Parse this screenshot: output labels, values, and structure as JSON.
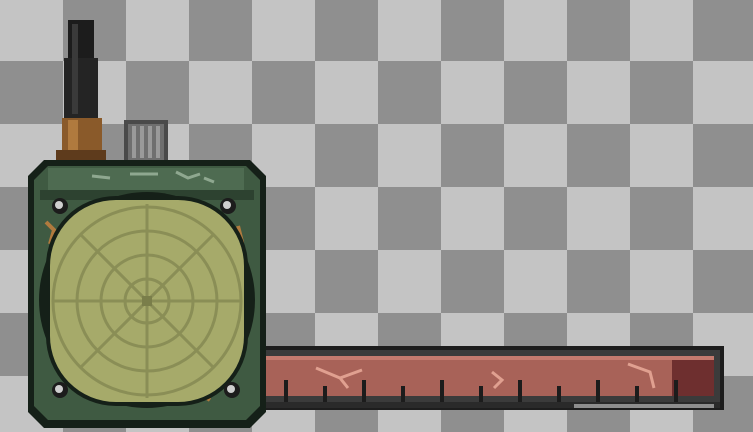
{
  "scene": {
    "kind": "radar scanner device sprite on transparent background",
    "colors": {
      "checker_light": "#c4c4c4",
      "checker_dark": "#8f8f8f",
      "casing": "#3f5a42",
      "casing_dark": "#1f2e22",
      "screen": "#a6aa6a",
      "screen_lines": "#8a8e56",
      "bar_fill": "#a86258",
      "bar_end": "#6e2f2f",
      "antenna": "#1c1c1c",
      "antenna_base": "#8a5a2a",
      "knob": "#6f6f6f"
    }
  },
  "device": {
    "antenna": {
      "icon": "antenna-icon"
    },
    "knob": {
      "icon": "knob-icon"
    },
    "radar": {
      "icon": "radar-screen-icon"
    },
    "gauge": {
      "icon": "gauge-bar-icon",
      "tick_count": 11
    }
  }
}
